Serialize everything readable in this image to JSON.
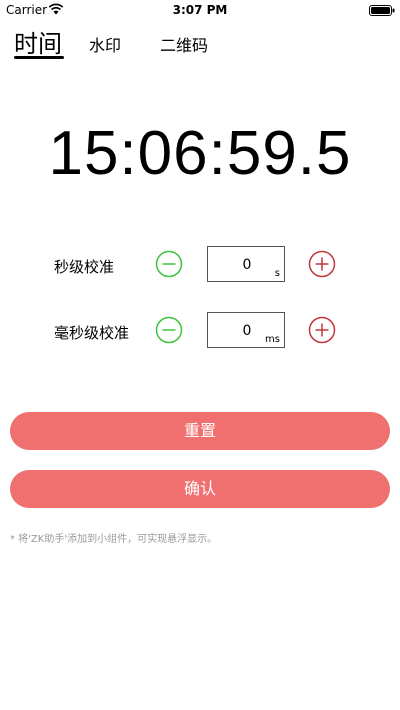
{
  "status_bar": {
    "carrier": "Carrier",
    "time": "3:07 PM"
  },
  "tabs": [
    {
      "label": "时间",
      "active": true
    },
    {
      "label": "水印",
      "active": false
    },
    {
      "label": "二维码",
      "active": false
    }
  ],
  "time_display": "15:06:59.5",
  "second_calibration": {
    "label": "秒级校准",
    "value": "0",
    "unit": "s"
  },
  "ms_calibration": {
    "label": "毫秒级校准",
    "value": "0",
    "unit": "ms"
  },
  "buttons": {
    "reset_label": "重置",
    "confirm_label": "确认"
  },
  "hint": "* 将'ZK助手'添加到小组件，可实现悬浮显示。",
  "colors": {
    "accent": "#f07070",
    "minus": "#3cc43c",
    "plus": "#c0363a"
  }
}
